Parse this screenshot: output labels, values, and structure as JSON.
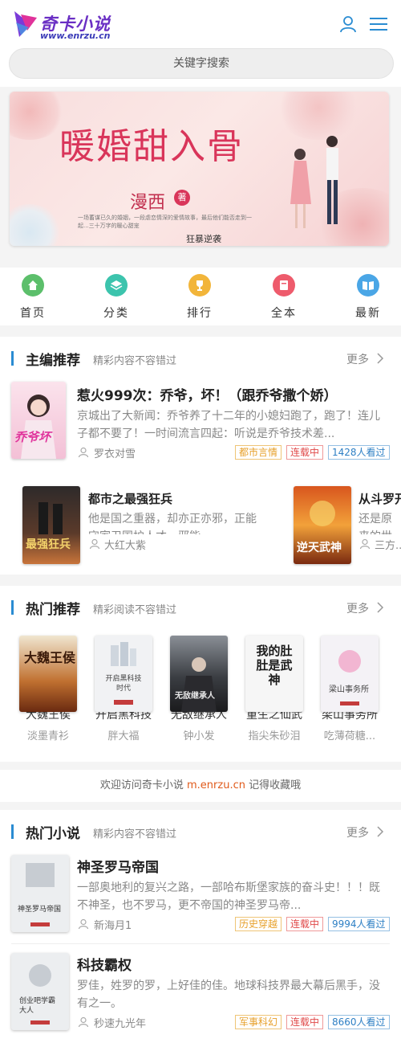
{
  "app": {
    "logo_title": "奇卡小说",
    "logo_url": "www.enrzu.cn",
    "logo_icon": "logo-mark",
    "user_icon": "user-icon",
    "menu_icon": "menu-icon",
    "accent": "#2a8cd2"
  },
  "search": {
    "placeholder": "关键字搜索"
  },
  "banner": {
    "title": "暖婚甜入骨",
    "author": "漫西",
    "author_tag": "著",
    "blurb": "一场蓄谋已久的婚姻，一段虐恋情深的爱情故事，最后他们能否走到一起...三十万字的暖心甜宠",
    "caption": "狂暴逆袭"
  },
  "nav": [
    {
      "label": "首页",
      "icon": "home-icon",
      "color": "#5cbf6b"
    },
    {
      "label": "分类",
      "icon": "layers-icon",
      "color": "#3cc4ad"
    },
    {
      "label": "排行",
      "icon": "trophy-icon",
      "color": "#f2b53a"
    },
    {
      "label": "全本",
      "icon": "book-icon",
      "color": "#ee5b6c"
    },
    {
      "label": "最新",
      "icon": "open-book-icon",
      "color": "#4aa6e6"
    }
  ],
  "editor_pick": {
    "title": "主编推荐",
    "subtitle": "精彩内容不容错过",
    "more": "更多",
    "featured": {
      "title": "惹火999次：乔爷，坏！（跟乔爷撒个娇）",
      "desc": "京城出了大新闻：乔爷养了十二年的小媳妇跑了，跑了！连儿子都不要了！一时间流言四起：听说是乔爷技术差...",
      "author": "罗衣对雪",
      "category": "都市言情",
      "status": "连载中",
      "views": "1428人看过",
      "cover_text": "乔爷坏"
    },
    "scroll": [
      {
        "title": "都市之最强狂兵",
        "desc": "他是国之重器，却亦正亦邪，正能守家卫国护人才，邪能...",
        "author": "大红大紫",
        "cover_text": "最强狂兵"
      },
      {
        "title": "从斗罗开始...",
        "desc": "还是原来的世界，不是原来的...",
        "author": "三方...",
        "cover_text": "逆天武神"
      }
    ]
  },
  "hot_recommend": {
    "title": "热门推荐",
    "subtitle": "精彩阅读不容错过",
    "more": "更多",
    "books": [
      {
        "name": "大魏王侯",
        "author": "淡墨青衫",
        "cover_text": "大魏王侯"
      },
      {
        "name": "开启黑科技",
        "author": "胖大福",
        "cover_text": "开启黑科技时代"
      },
      {
        "name": "无敌继承人",
        "author": "钟小发",
        "cover_text": "无敌继承人"
      },
      {
        "name": "重生之仙武",
        "author": "指尖朱砂泪",
        "cover_text": "我的肚肚是武神"
      },
      {
        "name": "梁山事务所",
        "author": "吃薄荷糖...",
        "cover_text": "梁山事务所"
      }
    ]
  },
  "welcome": {
    "prefix": "欢迎访问奇卡小说",
    "site": "m.enrzu.cn",
    "suffix": "记得收藏哦"
  },
  "hot_novels": {
    "title": "热门小说",
    "subtitle": "精彩内容不容错过",
    "more": "更多",
    "books": [
      {
        "title": "神圣罗马帝国",
        "desc": "一部奥地利的复兴之路，一部哈布斯堡家族的奋斗史！！！既不神圣，也不罗马，更不帝国的神圣罗马帝...",
        "author": "新海月1",
        "category": "历史穿越",
        "status": "连载中",
        "views": "9994人看过",
        "cover_text": "神圣罗马帝国"
      },
      {
        "title": "科技霸权",
        "desc": "罗佳，姓罗的罗，上好佳的佳。地球科技界最大幕后黑手，没有之一。",
        "author": "秒速九光年",
        "category": "军事科幻",
        "status": "连载中",
        "views": "8660人看过",
        "cover_text": "创业吧学霸大人"
      }
    ]
  }
}
